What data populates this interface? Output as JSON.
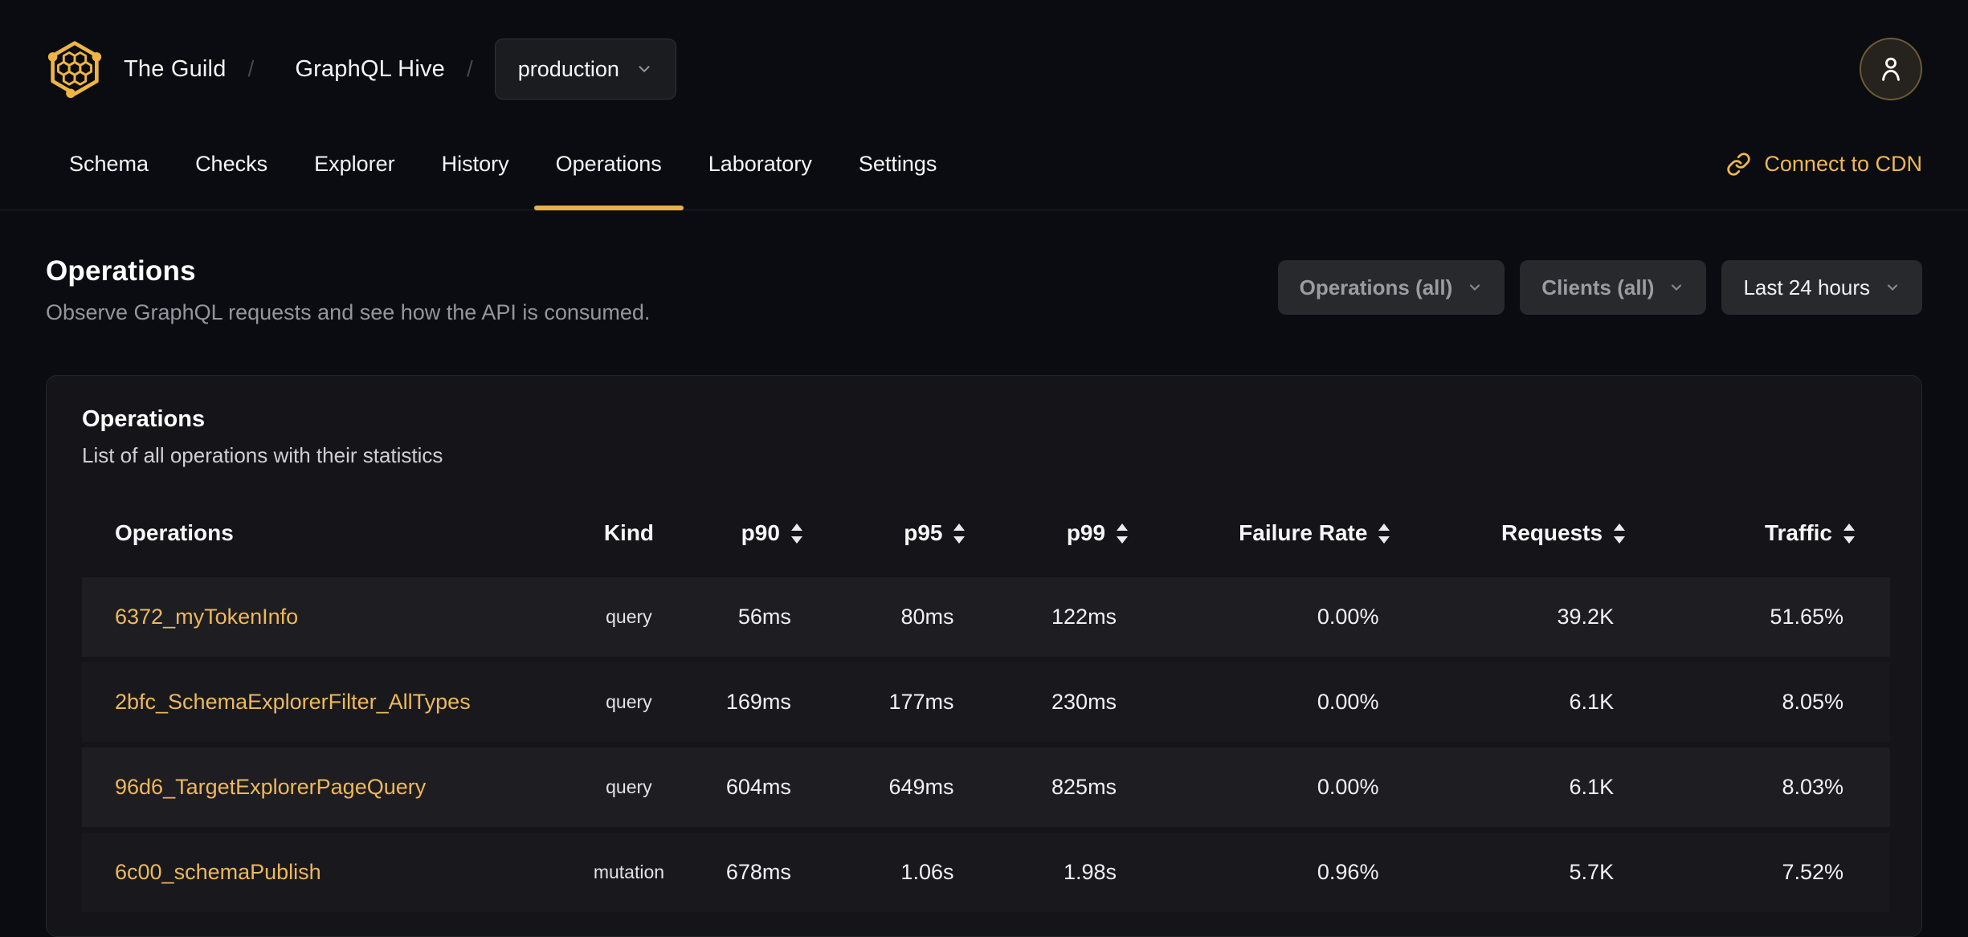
{
  "brand": {
    "org": "The Guild",
    "separator": "/",
    "project": "GraphQL Hive",
    "target_selected": "production"
  },
  "nav": {
    "tabs": [
      {
        "label": "Schema",
        "active": false
      },
      {
        "label": "Checks",
        "active": false
      },
      {
        "label": "Explorer",
        "active": false
      },
      {
        "label": "History",
        "active": false
      },
      {
        "label": "Operations",
        "active": true
      },
      {
        "label": "Laboratory",
        "active": false
      },
      {
        "label": "Settings",
        "active": false
      }
    ],
    "cdn_link": "Connect to CDN"
  },
  "page": {
    "title": "Operations",
    "subtitle": "Observe GraphQL requests and see how the API is consumed."
  },
  "filters": {
    "operations": "Operations (all)",
    "clients": "Clients (all)",
    "period": "Last 24 hours"
  },
  "panel": {
    "title": "Operations",
    "subtitle": "List of all operations with their statistics"
  },
  "table": {
    "columns": [
      {
        "label": "Operations",
        "sortable": false
      },
      {
        "label": "Kind",
        "sortable": false
      },
      {
        "label": "p90",
        "sortable": true
      },
      {
        "label": "p95",
        "sortable": true
      },
      {
        "label": "p99",
        "sortable": true
      },
      {
        "label": "Failure Rate",
        "sortable": true
      },
      {
        "label": "Requests",
        "sortable": true
      },
      {
        "label": "Traffic",
        "sortable": true
      }
    ],
    "rows": [
      {
        "name": "6372_myTokenInfo",
        "kind": "query",
        "p90": "56ms",
        "p95": "80ms",
        "p99": "122ms",
        "failure_rate": "0.00%",
        "requests": "39.2K",
        "traffic": "51.65%"
      },
      {
        "name": "2bfc_SchemaExplorerFilter_AllTypes",
        "kind": "query",
        "p90": "169ms",
        "p95": "177ms",
        "p99": "230ms",
        "failure_rate": "0.00%",
        "requests": "6.1K",
        "traffic": "8.05%"
      },
      {
        "name": "96d6_TargetExplorerPageQuery",
        "kind": "query",
        "p90": "604ms",
        "p95": "649ms",
        "p99": "825ms",
        "failure_rate": "0.00%",
        "requests": "6.1K",
        "traffic": "8.03%"
      },
      {
        "name": "6c00_schemaPublish",
        "kind": "mutation",
        "p90": "678ms",
        "p95": "1.06s",
        "p99": "1.98s",
        "failure_rate": "0.96%",
        "requests": "5.7K",
        "traffic": "7.52%"
      }
    ]
  },
  "icons": {
    "logo": "hive-honeycomb-icon",
    "avatar": "user-icon",
    "cdn": "link-icon",
    "dropdown": "chevron-down-icon",
    "sort": "sort-arrows-icon"
  },
  "colors": {
    "accent_gold": "#e9af4b",
    "link_gold": "#edb85c",
    "page_bg": "#0a0c11",
    "card_bg": "#151519",
    "row_odd": "#1e1e22",
    "row_even": "#19191d"
  }
}
